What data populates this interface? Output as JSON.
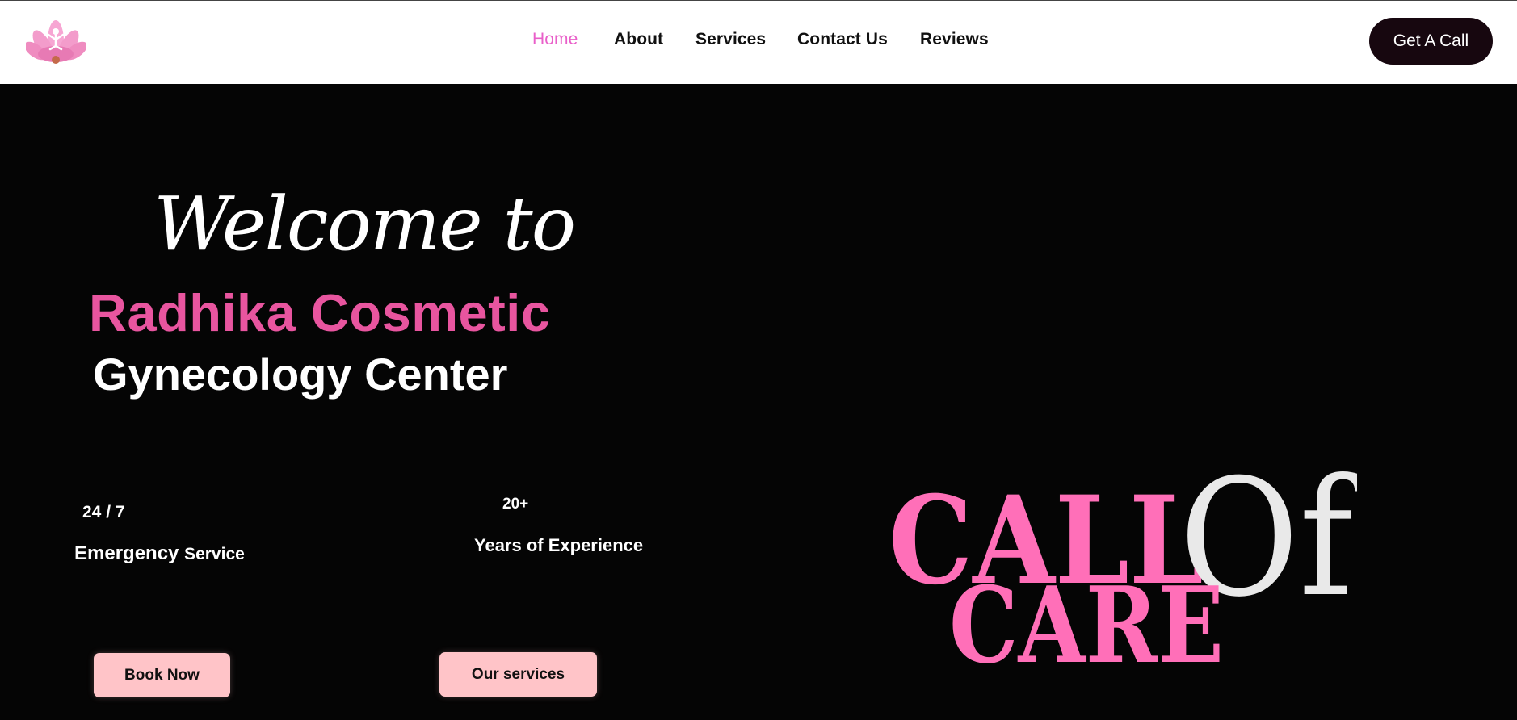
{
  "header": {
    "logo_icon": "lotus-yoga-logo-icon",
    "nav": [
      {
        "label": "Home",
        "active": true
      },
      {
        "label": "About",
        "active": false
      },
      {
        "label": "Services",
        "active": false
      },
      {
        "label": "Contact Us",
        "active": false
      },
      {
        "label": "Reviews",
        "active": false
      }
    ],
    "cta_label": "Get A Call"
  },
  "hero": {
    "welcome": "Welcome to",
    "brand": "Radhika Cosmetic",
    "subtitle": "Gynecology Center",
    "stats": [
      {
        "value": "24 / 7",
        "label_main": "Emergency",
        "label_extra": "Service"
      },
      {
        "value": "20+",
        "label_main": "Years of Experience"
      }
    ],
    "buttons": {
      "book": "Book Now",
      "services": "Our services"
    },
    "graphic": {
      "line1": "CALL",
      "line2": "CARE",
      "of": "Of"
    }
  },
  "colors": {
    "accent_pink": "#e8559f",
    "nav_active": "#e95fc9",
    "graphic_pink": "#ff6fb8",
    "button_pink": "#ffc4c8",
    "dark_button": "#17070f",
    "background": "#050505"
  }
}
